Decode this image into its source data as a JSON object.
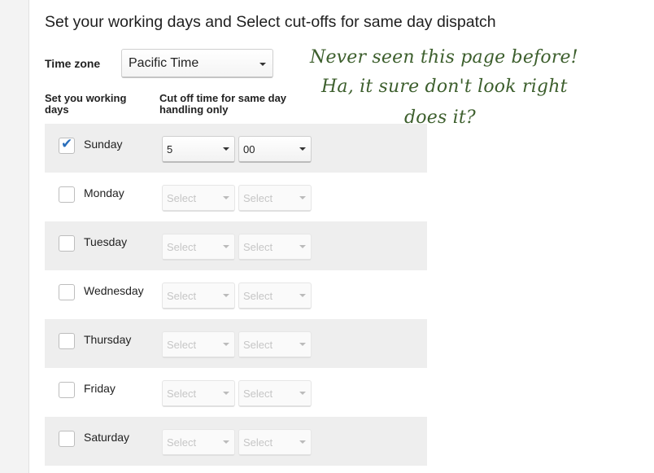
{
  "page_title": "Set your working days and Select cut-offs for same day dispatch",
  "timezone": {
    "label": "Time zone",
    "value": "Pacific Time"
  },
  "columns": {
    "days_header": "Set you working days",
    "cutoff_header": "Cut off time for same day handling only"
  },
  "days": [
    {
      "name": "Sunday",
      "checked": true,
      "hour": "5",
      "minute": "00"
    },
    {
      "name": "Monday",
      "checked": false,
      "hour": "Select",
      "minute": "Select"
    },
    {
      "name": "Tuesday",
      "checked": false,
      "hour": "Select",
      "minute": "Select"
    },
    {
      "name": "Wednesday",
      "checked": false,
      "hour": "Select",
      "minute": "Select"
    },
    {
      "name": "Thursday",
      "checked": false,
      "hour": "Select",
      "minute": "Select"
    },
    {
      "name": "Friday",
      "checked": false,
      "hour": "Select",
      "minute": "Select"
    },
    {
      "name": "Saturday",
      "checked": false,
      "hour": "Select",
      "minute": "Select"
    }
  ],
  "annotation": {
    "line1": "Never seen this page before!",
    "line2": "Ha, it sure don't look right",
    "line3": "does it?"
  }
}
